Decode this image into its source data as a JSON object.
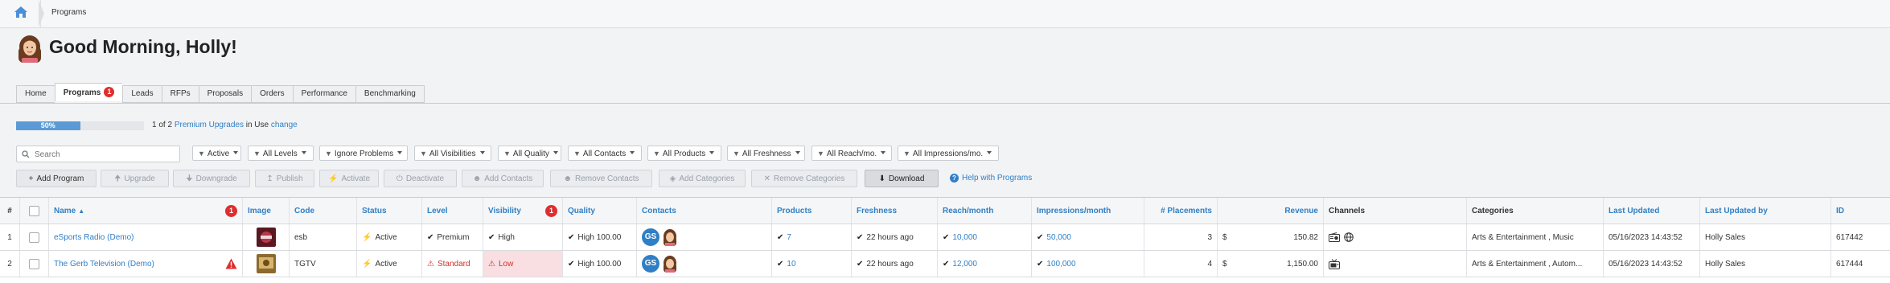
{
  "breadcrumb": {
    "current": "Programs"
  },
  "greeting": "Good Morning, Holly!",
  "tabs": [
    {
      "label": "Home"
    },
    {
      "label": "Programs",
      "badge": "1"
    },
    {
      "label": "Leads"
    },
    {
      "label": "RFPs"
    },
    {
      "label": "Proposals"
    },
    {
      "label": "Orders"
    },
    {
      "label": "Performance"
    },
    {
      "label": "Benchmarking"
    }
  ],
  "upgrades": {
    "progress_label": "50%",
    "progress_fraction": 0.5,
    "text": "1 of 2",
    "link": "Premium Upgrades",
    "suffix": "in Use",
    "change": "change"
  },
  "search": {
    "placeholder": "Search"
  },
  "filters": [
    "Active",
    "All Levels",
    "Ignore Problems",
    "All Visibilities",
    "All Quality",
    "All Contacts",
    "All Products",
    "All Freshness",
    "All Reach/mo.",
    "All Impressions/mo."
  ],
  "actions": [
    "Add Program",
    "Upgrade",
    "Downgrade",
    "Publish",
    "Activate",
    "Deactivate",
    "Add Contacts",
    "Remove Contacts",
    "Add Categories",
    "Remove Categories",
    "Download"
  ],
  "help": "Help with Programs",
  "table": {
    "headers": {
      "num": "#",
      "name": "Name",
      "name_badge": "1",
      "image": "Image",
      "code": "Code",
      "status": "Status",
      "level": "Level",
      "visibility": "Visibility",
      "visibility_badge": "1",
      "quality": "Quality",
      "contacts": "Contacts",
      "products": "Products",
      "freshness": "Freshness",
      "reach": "Reach/month",
      "impressions": "Impressions/month",
      "placements": "# Placements",
      "revenue": "Revenue",
      "channels": "Channels",
      "categories": "Categories",
      "last_updated": "Last Updated",
      "last_updated_by": "Last Updated by",
      "id": "ID"
    },
    "rows": [
      {
        "num": "1",
        "name": "eSports Radio (Demo)",
        "code": "esb",
        "status": "Active",
        "level": "Premium",
        "visibility": "High",
        "quality": "High 100.00",
        "contact_initials": "GS",
        "products": "7",
        "freshness": "22 hours ago",
        "reach": "10,000",
        "impressions": "50,000",
        "placements": "3",
        "currency": "$",
        "revenue": "150.82",
        "categories": "Arts & Entertainment , Music",
        "last_updated": "05/16/2023 14:43:52",
        "last_updated_by": "Holly Sales",
        "id": "617442"
      },
      {
        "num": "2",
        "name": "The Gerb Television (Demo)",
        "code": "TGTV",
        "status": "Active",
        "level": "Standard",
        "visibility": "Low",
        "quality": "High 100.00",
        "contact_initials": "GS",
        "products": "10",
        "freshness": "22 hours ago",
        "reach": "12,000",
        "impressions": "100,000",
        "placements": "4",
        "currency": "$",
        "revenue": "1,150.00",
        "categories": "Arts & Entertainment , Autom...",
        "last_updated": "05/16/2023 14:43:52",
        "last_updated_by": "Holly Sales",
        "id": "617444"
      }
    ]
  }
}
